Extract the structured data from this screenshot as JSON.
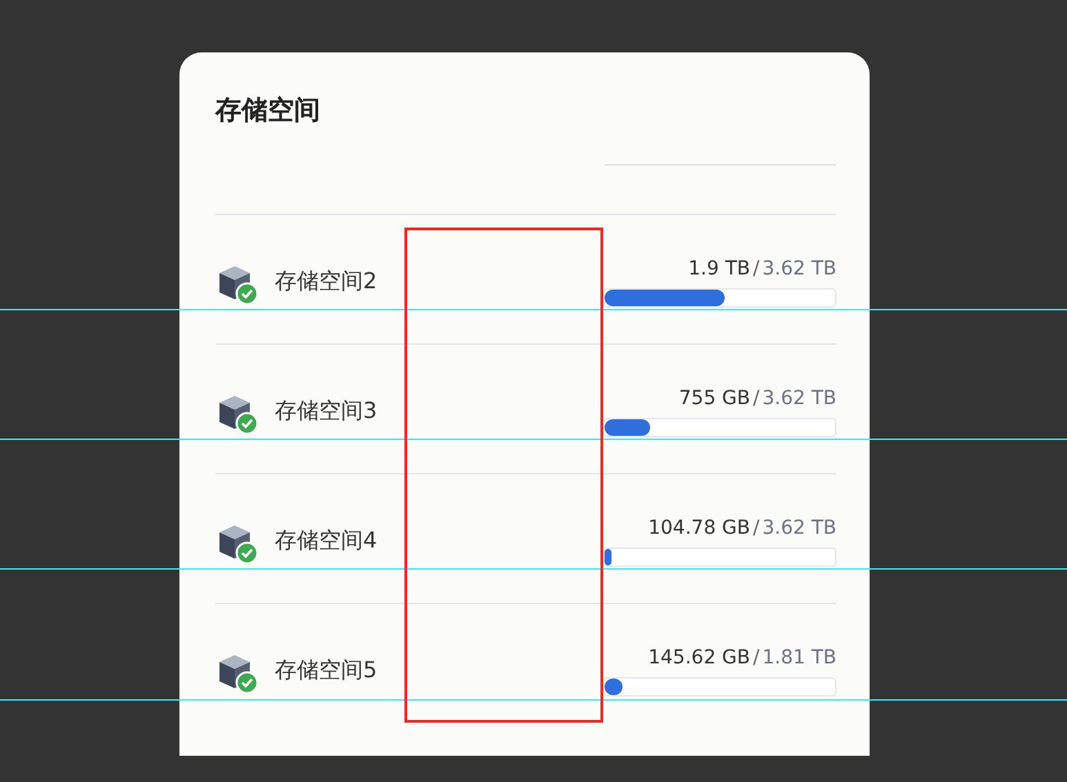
{
  "panel": {
    "title": "存储空间"
  },
  "volumes": [
    {
      "name": "存储空间2",
      "used": "1.9 TB",
      "separator": "/",
      "total": "3.62 TB",
      "level": 0.52,
      "healthy": true
    },
    {
      "name": "存储空间3",
      "used": "755 GB",
      "separator": "/",
      "total": "3.62 TB",
      "level": 0.2,
      "healthy": true
    },
    {
      "name": "存储空间4",
      "used": "104.78 GB",
      "separator": "/",
      "total": "3.62 TB",
      "level": 0.03,
      "healthy": true
    },
    {
      "name": "存储空间5",
      "used": "145.62 GB",
      "separator": "/",
      "total": "1.81 TB",
      "level": 0.08,
      "healthy": true
    }
  ]
}
